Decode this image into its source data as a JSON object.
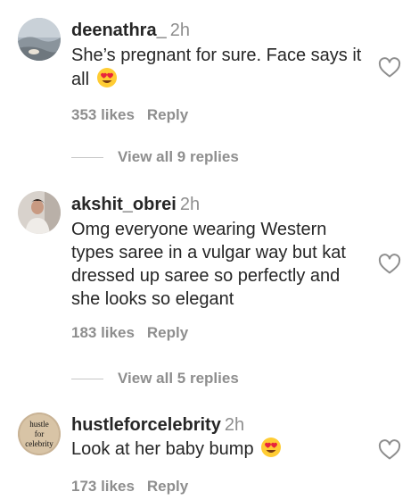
{
  "comments": [
    {
      "username": "deenathra_",
      "time": "2h",
      "text": "She’s pregnant for sure. Face says it all",
      "emoji": "smiling-face-with-heart-eyes",
      "likes": "353 likes",
      "reply_label": "Reply",
      "view_replies": "View all 9 replies",
      "avatar_icon": "landscape-photo"
    },
    {
      "username": "akshit_obrei",
      "time": "2h",
      "text": "Omg everyone wearing Western types saree in a vulgar way but kat dressed up saree so perfectly and she looks so elegant",
      "likes": "183 likes",
      "reply_label": "Reply",
      "view_replies": "View all 5 replies",
      "avatar_icon": "person-photo"
    },
    {
      "username": "hustleforcelebrity",
      "time": "2h",
      "text": "Look at her baby bump",
      "emoji": "smiling-face-with-heart-eyes",
      "likes": "173 likes",
      "reply_label": "Reply",
      "avatar_icon": "text-logo",
      "avatar_text": [
        "hustle",
        "for",
        "celebrity"
      ]
    }
  ],
  "icons": {
    "like": "heart-outline-icon"
  },
  "colors": {
    "text": "#262626",
    "muted": "#8e8e8e",
    "divider": "#c7c7c7"
  }
}
